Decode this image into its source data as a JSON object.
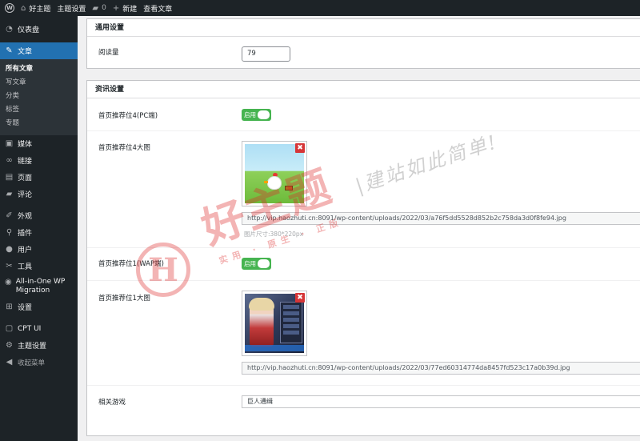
{
  "adminbar": {
    "site_name": "好主题",
    "theme_settings": "主题设置",
    "comments_count": "0",
    "new_label": "新建",
    "view_post": "查看文章"
  },
  "sidebar": {
    "dashboard": "仪表盘",
    "posts": "文章",
    "posts_sub": [
      "所有文章",
      "写文章",
      "分类",
      "标签",
      "专题"
    ],
    "media": "媒体",
    "links": "链接",
    "pages": "页面",
    "comments": "评论",
    "appearance": "外观",
    "plugins": "插件",
    "users": "用户",
    "tools": "工具",
    "migration": "All-in-One WP Migration",
    "settings": "设置",
    "cpt_ui": "CPT UI",
    "theme_settings": "主题设置",
    "collapse": "收起菜单"
  },
  "general_panel": {
    "title": "通用设置",
    "read_count_label": "阅读量",
    "read_count_value": "79"
  },
  "news_panel": {
    "title": "资讯设置",
    "pc_slot_label": "首页推荐位4(PC端)",
    "pc_toggle_label": "启用",
    "pc_image_label": "首页推荐位4大图",
    "pc_image_url": "http://vip.haozhuti.cn:8091/wp-content/uploads/2022/03/a76f5dd5528d852b2c758da3d0f8fe94.jpg",
    "pc_image_hint": "图片尺寸:380*220px",
    "wap_slot_label": "首页推荐位1(WAP端)",
    "wap_toggle_label": "启用",
    "wap_image_label": "首页推荐位1大图",
    "wap_image_url": "http://vip.haozhuti.cn:8091/wp-content/uploads/2022/03/77ed60314774da8457fd523c17a0b39d.jpg",
    "related_game_label": "相关游戏",
    "related_game_value": "巨人通缉",
    "remove_glyph": "✖"
  },
  "watermark": {
    "brand": "好主题",
    "sub": "实用 · 原生 · 正版",
    "slogan": "|建站如此简单!",
    "logo_letter": "H"
  },
  "colors": {
    "sidebar_bg": "#1d2327",
    "active_menu": "#2271b1",
    "toggle_on": "#46b450",
    "remove_button": "#d63638"
  }
}
